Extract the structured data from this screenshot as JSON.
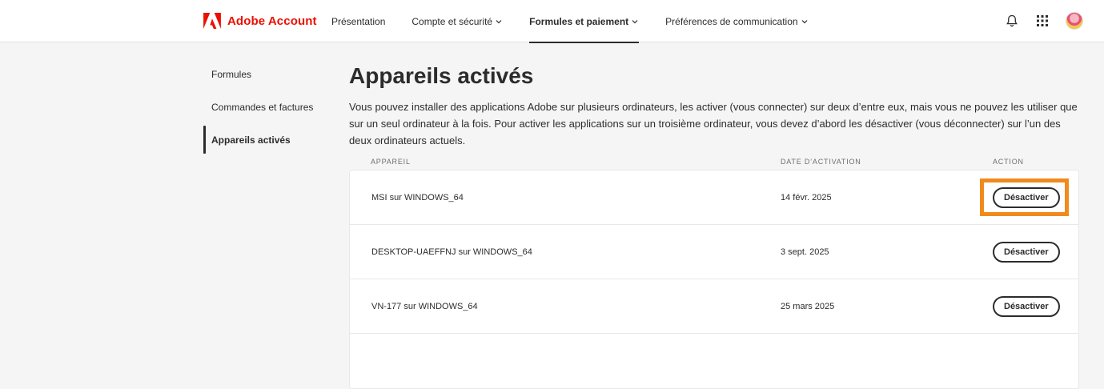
{
  "header": {
    "brand": "Adobe Account",
    "nav": [
      {
        "label": "Présentation",
        "dropdown": false,
        "active": false
      },
      {
        "label": "Compte et sécurité",
        "dropdown": true,
        "active": false
      },
      {
        "label": "Formules et paiement",
        "dropdown": true,
        "active": true
      },
      {
        "label": "Préférences de communication",
        "dropdown": true,
        "active": false
      }
    ],
    "icons": [
      "bell-icon",
      "apps-grid-icon",
      "avatar"
    ]
  },
  "sidebar": {
    "items": [
      {
        "label": "Formules",
        "active": false
      },
      {
        "label": "Commandes et factures",
        "active": false
      },
      {
        "label": "Appareils activés",
        "active": true
      }
    ]
  },
  "main": {
    "title": "Appareils activés",
    "description": "Vous pouvez installer des applications Adobe sur plusieurs ordinateurs, les activer (vous connecter) sur deux d’entre eux, mais vous ne pouvez les utiliser que sur un seul ordinateur à la fois. Pour activer les applications sur un troisième ordinateur, vous devez d’abord les désactiver (vous déconnecter) sur l’un des deux ordinateurs actuels.",
    "columns": {
      "device": "APPAREIL",
      "date": "DATE D’ACTIVATION",
      "action": "ACTION"
    },
    "rows": [
      {
        "device": "MSI sur WINDOWS_64",
        "date": "14 févr. 2025",
        "action": "Désactiver"
      },
      {
        "device": "DESKTOP-UAEFFNJ sur WINDOWS_64",
        "date": "3 sept. 2025",
        "action": "Désactiver"
      },
      {
        "device": "VN-177 sur WINDOWS_64",
        "date": "25 mars 2025",
        "action": "Désactiver"
      }
    ]
  },
  "colors": {
    "brand": "#eb1000",
    "highlight": "#f08a1c"
  }
}
